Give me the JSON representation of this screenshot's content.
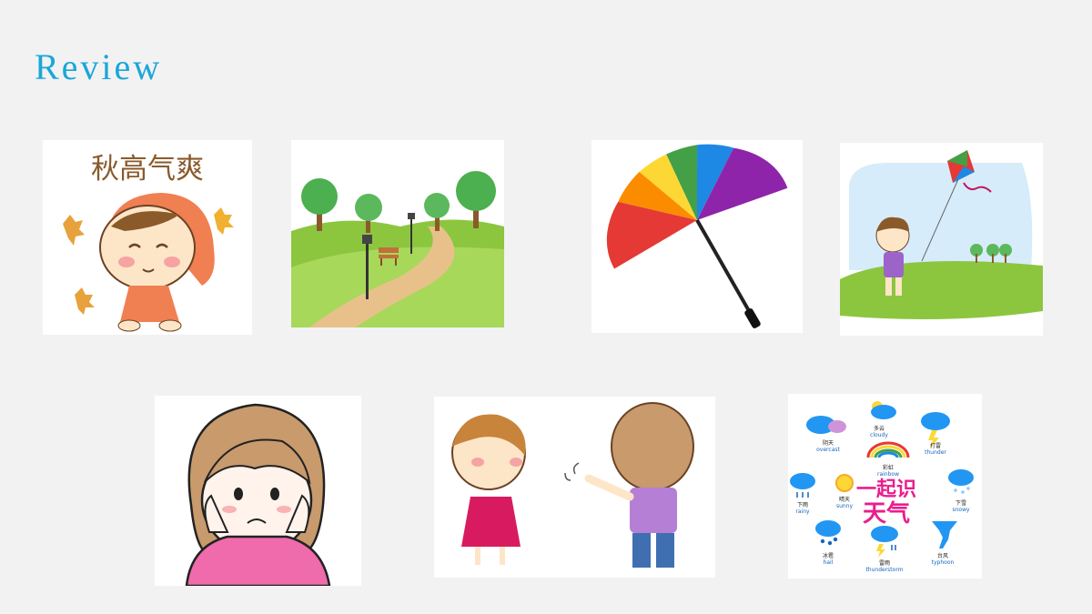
{
  "slide": {
    "title": "Review",
    "title_color": "#1ba6d8",
    "background": "#f2f2f2"
  },
  "images": [
    {
      "name": "autumn-girl-image",
      "caption": "秋高气爽"
    },
    {
      "name": "park-path-image"
    },
    {
      "name": "rainbow-umbrella-image"
    },
    {
      "name": "kite-girl-image"
    },
    {
      "name": "worried-girl-image"
    },
    {
      "name": "waving-children-image"
    },
    {
      "name": "weather-chart-image",
      "center_text": [
        "一起识",
        "天气"
      ],
      "items": [
        {
          "icon": "cloud-sun-icon",
          "zh": "多云",
          "en": "cloudy"
        },
        {
          "icon": "cloud-face-icon",
          "zh": "阴天",
          "en": "overcast"
        },
        {
          "icon": "thunder-cloud-icon",
          "zh": "打雷",
          "en": "thunder"
        },
        {
          "icon": "rainbow-icon",
          "zh": "彩虹",
          "en": "rainbow"
        },
        {
          "icon": "rain-cloud-icon",
          "zh": "下雨",
          "en": "rainy"
        },
        {
          "icon": "sun-icon",
          "zh": "晴天",
          "en": "sunny"
        },
        {
          "icon": "snow-cloud-icon",
          "zh": "下雪",
          "en": "snowy"
        },
        {
          "icon": "hail-cloud-icon",
          "zh": "冰雹",
          "en": "hail"
        },
        {
          "icon": "storm-cloud-icon",
          "zh": "雷雨",
          "en": "thunderstorm"
        },
        {
          "icon": "tornado-icon",
          "zh": "台风",
          "en": "typhoon"
        }
      ]
    }
  ]
}
